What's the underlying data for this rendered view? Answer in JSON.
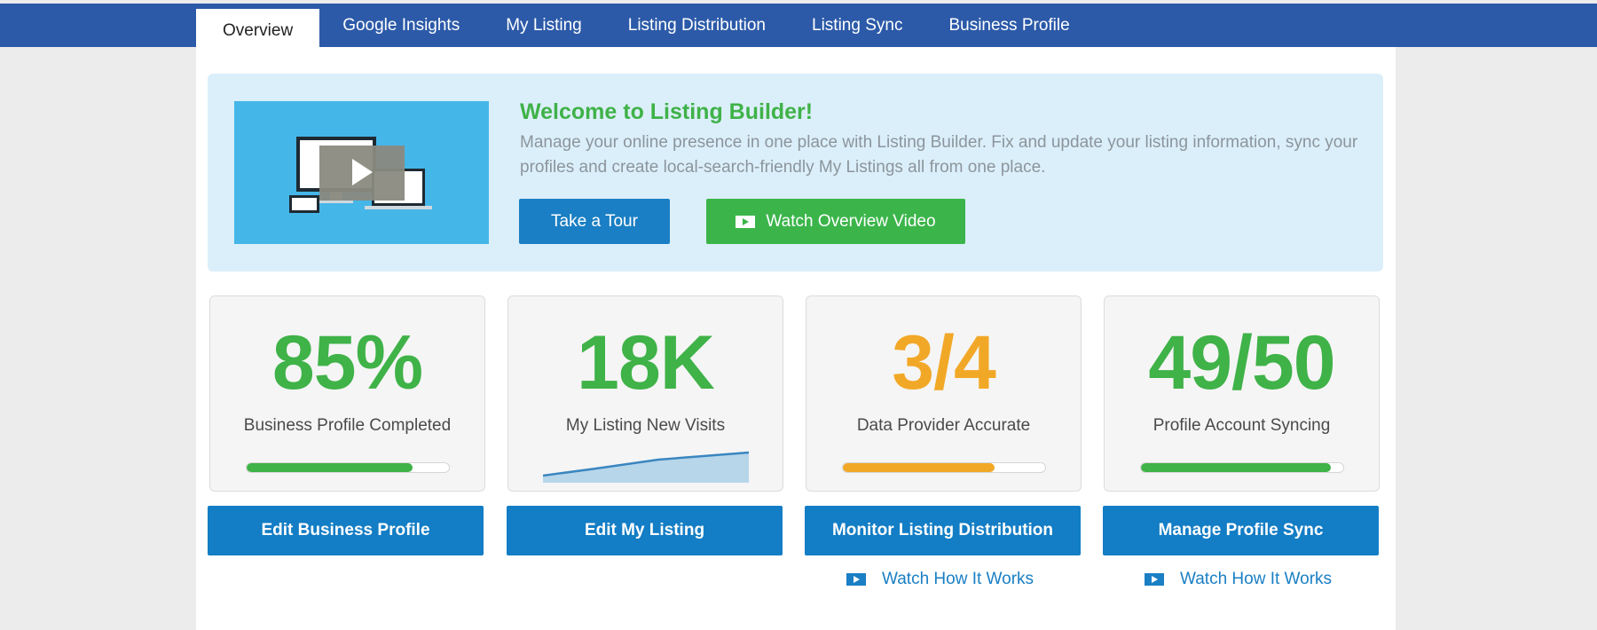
{
  "nav": {
    "tabs": [
      {
        "label": "Overview",
        "active": true
      },
      {
        "label": "Google Insights"
      },
      {
        "label": "My Listing"
      },
      {
        "label": "Listing Distribution"
      },
      {
        "label": "Listing Sync"
      },
      {
        "label": "Business Profile"
      }
    ]
  },
  "welcome": {
    "title": "Welcome to Listing Builder!",
    "text": "Manage your online presence in one place with Listing Builder. Fix and update your listing information, sync your profiles and create local-search-friendly My Listings all from one place.",
    "tour_button": "Take a Tour",
    "video_button": "Watch Overview Video"
  },
  "cards": [
    {
      "value": "85%",
      "label": "Business Profile Completed",
      "color": "#3fb248",
      "progress": 0.82,
      "button": "Edit Business Profile"
    },
    {
      "value": "18K",
      "label": "My Listing New Visits",
      "color": "#3fb248",
      "button": "Edit My Listing"
    },
    {
      "value": "3/4",
      "label": "Data Provider Accurate",
      "color": "#f2a827",
      "progress": 0.75,
      "button": "Monitor Listing Distribution",
      "link": "Watch How It Works"
    },
    {
      "value": "49/50",
      "label": "Profile Account Syncing",
      "color": "#3fb248",
      "progress": 0.94,
      "button": "Manage Profile Sync",
      "link": "Watch How It Works"
    }
  ],
  "colors": {
    "nav_bg": "#2c5aa8",
    "primary_blue": "#137dc5",
    "success_green": "#3bb54a",
    "warning_orange": "#f2a827"
  }
}
